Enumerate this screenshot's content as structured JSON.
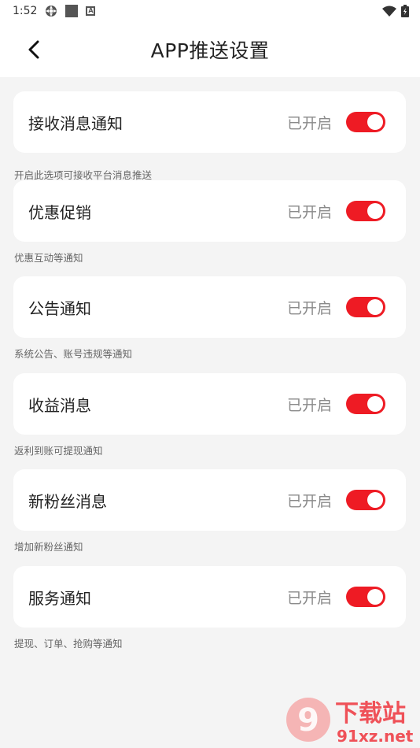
{
  "status_bar": {
    "time": "1:52",
    "icons": [
      "settings-status-icon",
      "square-status-icon",
      "a-status-icon",
      "wifi-icon",
      "battery-icon"
    ]
  },
  "header": {
    "title": "APP推送设置",
    "back_icon": "chevron-left-icon"
  },
  "settings": [
    {
      "label": "接收消息通知",
      "status": "已开启",
      "enabled": true,
      "desc": "开启此选项可接收平台消息推送"
    },
    {
      "label": "优惠促销",
      "status": "已开启",
      "enabled": true,
      "desc": "优惠互动等通知"
    },
    {
      "label": "公告通知",
      "status": "已开启",
      "enabled": true,
      "desc": "系统公告、账号违规等通知"
    },
    {
      "label": "收益消息",
      "status": "已开启",
      "enabled": true,
      "desc": "返利到账可提现通知"
    },
    {
      "label": "新粉丝消息",
      "status": "已开启",
      "enabled": true,
      "desc": "增加新粉丝通知"
    },
    {
      "label": "服务通知",
      "status": "已开启",
      "enabled": true,
      "desc": "提现、订单、抢购等通知"
    }
  ],
  "colors": {
    "accent": "#ee1b24",
    "background": "#f4f4f4",
    "card": "#ffffff"
  },
  "watermark": {
    "logo": "9",
    "title": "下载站",
    "url": "91xz.net"
  }
}
